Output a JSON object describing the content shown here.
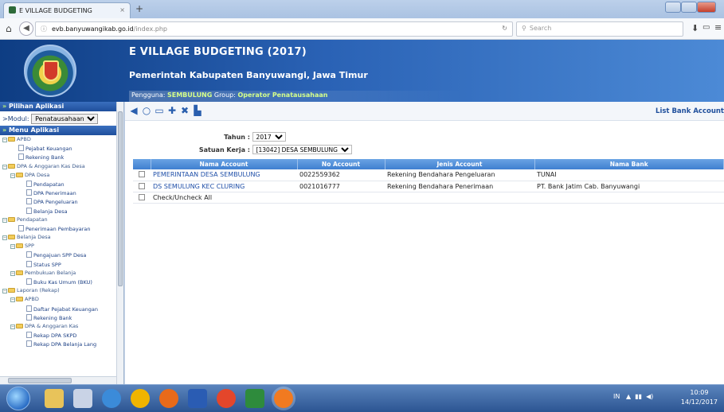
{
  "browser": {
    "tab_title": "E VILLAGE BUDGETING",
    "tab_close": "×",
    "new_tab": "+",
    "url_domain": "evb.banyuwangikab.go.id",
    "url_path": "/index.php",
    "search_placeholder": "Search"
  },
  "header": {
    "title": "E VILLAGE BUDGETING (2017)",
    "subtitle": "Pemerintah Kabupaten Banyuwangi, Jawa Timur",
    "user_prefix": "Pengguna: ",
    "user_name": "SEMBULUNG",
    "group_prefix": " Group: ",
    "group_name": "Operator Penatausahaan"
  },
  "sidebar": {
    "pilihan_label": "Pilihan Aplikasi",
    "modul_label": ">Modul:",
    "modul_value": "Penatausahaan",
    "menu_label": "Menu Aplikasi",
    "tree": [
      {
        "label": "APBD",
        "level": 0,
        "type": "folder"
      },
      {
        "label": "Pejabat Keuangan",
        "level": 1,
        "type": "leaf"
      },
      {
        "label": "Rekening Bank",
        "level": 1,
        "type": "leaf"
      },
      {
        "label": "DPA & Anggaran Kas Desa",
        "level": 0,
        "type": "folder"
      },
      {
        "label": "DPA Desa",
        "level": 1,
        "type": "folder"
      },
      {
        "label": "Pendapatan",
        "level": 2,
        "type": "leaf"
      },
      {
        "label": "DPA Penerimaan",
        "level": 2,
        "type": "leaf"
      },
      {
        "label": "DPA Pengeluaran",
        "level": 2,
        "type": "leaf"
      },
      {
        "label": "Belanja Desa",
        "level": 2,
        "type": "leaf"
      },
      {
        "label": "Pendapatan",
        "level": 0,
        "type": "folder"
      },
      {
        "label": "Penerimaan Pembayaran",
        "level": 1,
        "type": "leaf"
      },
      {
        "label": "Belanja Desa",
        "level": 0,
        "type": "folder"
      },
      {
        "label": "SPP",
        "level": 1,
        "type": "folder"
      },
      {
        "label": "Pengajuan SPP Desa",
        "level": 2,
        "type": "leaf"
      },
      {
        "label": "Status SPP",
        "level": 2,
        "type": "leaf"
      },
      {
        "label": "Pembukuan Belanja",
        "level": 1,
        "type": "folder"
      },
      {
        "label": "Buku Kas Umum (BKU)",
        "level": 2,
        "type": "leaf"
      },
      {
        "label": "Laporan (Rekap)",
        "level": 0,
        "type": "folder"
      },
      {
        "label": "APBD",
        "level": 1,
        "type": "folder"
      },
      {
        "label": "Daftar Pejabat Keuangan",
        "level": 2,
        "type": "leaf"
      },
      {
        "label": "Rekening Bank",
        "level": 2,
        "type": "leaf"
      },
      {
        "label": "DPA & Anggaran Kas",
        "level": 1,
        "type": "folder"
      },
      {
        "label": "Rekap DPA SKPD",
        "level": 2,
        "type": "leaf"
      },
      {
        "label": "Rekap DPA Belanja Lang",
        "level": 2,
        "type": "leaf"
      }
    ]
  },
  "toolbar": {
    "title": "List Bank Account"
  },
  "filters": {
    "tahun_label": "Tahun :",
    "tahun_value": "2017",
    "satker_label": "Satuan Kerja :",
    "satker_value": "[13042] DESA SEMBULUNG"
  },
  "table": {
    "headers": [
      "Nama Account",
      "No Account",
      "Jenis Account",
      "Nama Bank"
    ],
    "rows": [
      [
        "PEMERINTAAN DESA SEMBULUNG",
        "0022559362",
        "Rekening Bendahara Pengeluaran",
        "TUNAI"
      ],
      [
        "DS SEMULUNG KEC CLURING",
        "0021016777",
        "Rekening Bendahara Penerimaan",
        "PT. Bank Jatim Cab. Banyuwangi"
      ]
    ],
    "check_all": "Check/Uncheck All"
  },
  "taskbar": {
    "tray": "IN",
    "time": "10:09",
    "date": "14/12/2017"
  }
}
